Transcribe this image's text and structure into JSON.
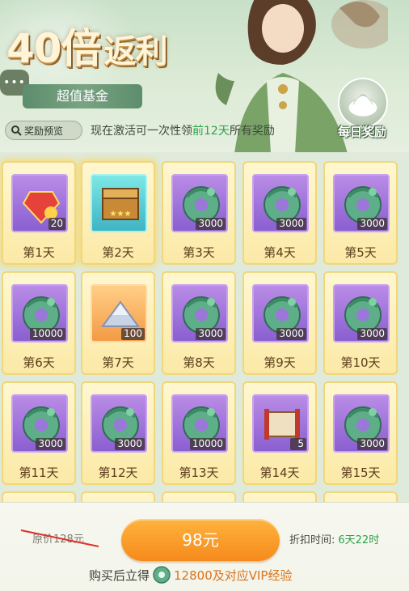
{
  "header": {
    "title_main": "40倍",
    "title_suffix": "返利",
    "chat_icon": "chat-bubble-icon",
    "fund_label": "超值基金",
    "preview_label": "奖励预览",
    "desc_prefix": "现在激活可一次性领",
    "desc_highlight": "前12天",
    "desc_suffix": "所有奖励",
    "daily_reward_label": "每日奖励"
  },
  "days": [
    {
      "day": "第1天",
      "qty": "20",
      "item": "red-gem-icon",
      "thumb": "purple"
    },
    {
      "day": "第2天",
      "qty": "",
      "item": "treasure-chest-icon",
      "thumb": "cyan"
    },
    {
      "day": "第3天",
      "qty": "3000",
      "item": "jade-coin-icon",
      "thumb": "purple"
    },
    {
      "day": "第4天",
      "qty": "3000",
      "item": "jade-coin-icon",
      "thumb": "purple"
    },
    {
      "day": "第5天",
      "qty": "3000",
      "item": "jade-coin-icon",
      "thumb": "purple"
    },
    {
      "day": "第6天",
      "qty": "10000",
      "item": "jade-coin-icon",
      "thumb": "purple"
    },
    {
      "day": "第7天",
      "qty": "100",
      "item": "silver-pile-icon",
      "thumb": "orange"
    },
    {
      "day": "第8天",
      "qty": "3000",
      "item": "jade-coin-icon",
      "thumb": "purple"
    },
    {
      "day": "第9天",
      "qty": "3000",
      "item": "jade-coin-icon",
      "thumb": "purple"
    },
    {
      "day": "第10天",
      "qty": "3000",
      "item": "jade-coin-icon",
      "thumb": "purple"
    },
    {
      "day": "第11天",
      "qty": "3000",
      "item": "jade-coin-icon",
      "thumb": "purple"
    },
    {
      "day": "第12天",
      "qty": "3000",
      "item": "jade-coin-icon",
      "thumb": "purple"
    },
    {
      "day": "第13天",
      "qty": "10000",
      "item": "jade-coin-icon",
      "thumb": "purple"
    },
    {
      "day": "第14天",
      "qty": "5",
      "item": "scroll-icon",
      "thumb": "purple"
    },
    {
      "day": "第15天",
      "qty": "3000",
      "item": "jade-coin-icon",
      "thumb": "purple"
    }
  ],
  "bottom": {
    "original_price": "原价128元",
    "buy_label": "98元",
    "discount_label": "折扣时间:",
    "discount_time": "6天22时",
    "reward_prefix": "购买后立得",
    "reward_amount": "12800及对应VIP经验"
  },
  "colors": {
    "accent_orange": "#f58a1c",
    "highlight_green": "#2aa24a",
    "card_gold": "#fbe9a6",
    "thumb_purple": "#8a5fd0"
  }
}
